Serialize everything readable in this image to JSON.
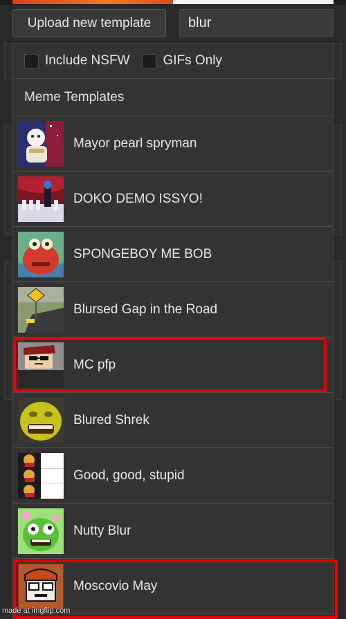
{
  "toolbar": {
    "upload_label": "Upload new template",
    "search_value": "blur"
  },
  "filters": {
    "nsfw_label": "Include NSFW",
    "gifs_label": "GIFs Only"
  },
  "section_title": "Meme Templates",
  "templates": [
    {
      "label": "Mayor pearl spryman",
      "icon": "mayor-pearl-thumbnail"
    },
    {
      "label": "DOKO DEMO ISSYO!",
      "icon": "doko-demo-thumbnail"
    },
    {
      "label": "SPONGEBOY ME BOB",
      "icon": "mr-krabs-thumbnail"
    },
    {
      "label": "Blursed Gap in the Road",
      "icon": "road-gap-thumbnail"
    },
    {
      "label": "MC pfp",
      "icon": "roblox-avatar-thumbnail",
      "highlighted": true
    },
    {
      "label": "Blured Shrek",
      "icon": "shrek-thumbnail"
    },
    {
      "label": "Good, good, stupid",
      "icon": "winnie-pooh-thumbnail"
    },
    {
      "label": "Nutty Blur",
      "icon": "nutty-thumbnail"
    },
    {
      "label": "Moscovio May",
      "icon": "cartoon-avatar-thumbnail",
      "highlighted": true
    }
  ],
  "watermark": "made at imgflip.com",
  "colors": {
    "highlight": "#e60000",
    "background": "#2a2a2a",
    "panel": "#333333"
  }
}
